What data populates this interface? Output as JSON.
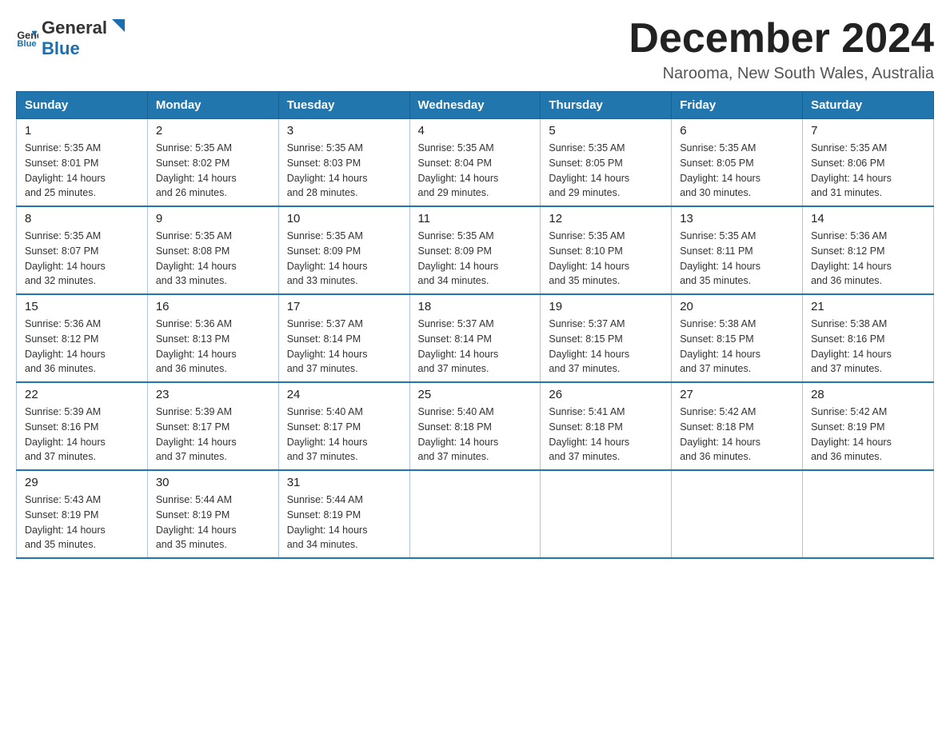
{
  "header": {
    "logo_general": "General",
    "logo_blue": "Blue",
    "month_title": "December 2024",
    "location": "Narooma, New South Wales, Australia"
  },
  "days_of_week": [
    "Sunday",
    "Monday",
    "Tuesday",
    "Wednesday",
    "Thursday",
    "Friday",
    "Saturday"
  ],
  "weeks": [
    [
      {
        "day": "1",
        "sunrise": "5:35 AM",
        "sunset": "8:01 PM",
        "daylight": "14 hours and 25 minutes."
      },
      {
        "day": "2",
        "sunrise": "5:35 AM",
        "sunset": "8:02 PM",
        "daylight": "14 hours and 26 minutes."
      },
      {
        "day": "3",
        "sunrise": "5:35 AM",
        "sunset": "8:03 PM",
        "daylight": "14 hours and 28 minutes."
      },
      {
        "day": "4",
        "sunrise": "5:35 AM",
        "sunset": "8:04 PM",
        "daylight": "14 hours and 29 minutes."
      },
      {
        "day": "5",
        "sunrise": "5:35 AM",
        "sunset": "8:05 PM",
        "daylight": "14 hours and 29 minutes."
      },
      {
        "day": "6",
        "sunrise": "5:35 AM",
        "sunset": "8:05 PM",
        "daylight": "14 hours and 30 minutes."
      },
      {
        "day": "7",
        "sunrise": "5:35 AM",
        "sunset": "8:06 PM",
        "daylight": "14 hours and 31 minutes."
      }
    ],
    [
      {
        "day": "8",
        "sunrise": "5:35 AM",
        "sunset": "8:07 PM",
        "daylight": "14 hours and 32 minutes."
      },
      {
        "day": "9",
        "sunrise": "5:35 AM",
        "sunset": "8:08 PM",
        "daylight": "14 hours and 33 minutes."
      },
      {
        "day": "10",
        "sunrise": "5:35 AM",
        "sunset": "8:09 PM",
        "daylight": "14 hours and 33 minutes."
      },
      {
        "day": "11",
        "sunrise": "5:35 AM",
        "sunset": "8:09 PM",
        "daylight": "14 hours and 34 minutes."
      },
      {
        "day": "12",
        "sunrise": "5:35 AM",
        "sunset": "8:10 PM",
        "daylight": "14 hours and 35 minutes."
      },
      {
        "day": "13",
        "sunrise": "5:35 AM",
        "sunset": "8:11 PM",
        "daylight": "14 hours and 35 minutes."
      },
      {
        "day": "14",
        "sunrise": "5:36 AM",
        "sunset": "8:12 PM",
        "daylight": "14 hours and 36 minutes."
      }
    ],
    [
      {
        "day": "15",
        "sunrise": "5:36 AM",
        "sunset": "8:12 PM",
        "daylight": "14 hours and 36 minutes."
      },
      {
        "day": "16",
        "sunrise": "5:36 AM",
        "sunset": "8:13 PM",
        "daylight": "14 hours and 36 minutes."
      },
      {
        "day": "17",
        "sunrise": "5:37 AM",
        "sunset": "8:14 PM",
        "daylight": "14 hours and 37 minutes."
      },
      {
        "day": "18",
        "sunrise": "5:37 AM",
        "sunset": "8:14 PM",
        "daylight": "14 hours and 37 minutes."
      },
      {
        "day": "19",
        "sunrise": "5:37 AM",
        "sunset": "8:15 PM",
        "daylight": "14 hours and 37 minutes."
      },
      {
        "day": "20",
        "sunrise": "5:38 AM",
        "sunset": "8:15 PM",
        "daylight": "14 hours and 37 minutes."
      },
      {
        "day": "21",
        "sunrise": "5:38 AM",
        "sunset": "8:16 PM",
        "daylight": "14 hours and 37 minutes."
      }
    ],
    [
      {
        "day": "22",
        "sunrise": "5:39 AM",
        "sunset": "8:16 PM",
        "daylight": "14 hours and 37 minutes."
      },
      {
        "day": "23",
        "sunrise": "5:39 AM",
        "sunset": "8:17 PM",
        "daylight": "14 hours and 37 minutes."
      },
      {
        "day": "24",
        "sunrise": "5:40 AM",
        "sunset": "8:17 PM",
        "daylight": "14 hours and 37 minutes."
      },
      {
        "day": "25",
        "sunrise": "5:40 AM",
        "sunset": "8:18 PM",
        "daylight": "14 hours and 37 minutes."
      },
      {
        "day": "26",
        "sunrise": "5:41 AM",
        "sunset": "8:18 PM",
        "daylight": "14 hours and 37 minutes."
      },
      {
        "day": "27",
        "sunrise": "5:42 AM",
        "sunset": "8:18 PM",
        "daylight": "14 hours and 36 minutes."
      },
      {
        "day": "28",
        "sunrise": "5:42 AM",
        "sunset": "8:19 PM",
        "daylight": "14 hours and 36 minutes."
      }
    ],
    [
      {
        "day": "29",
        "sunrise": "5:43 AM",
        "sunset": "8:19 PM",
        "daylight": "14 hours and 35 minutes."
      },
      {
        "day": "30",
        "sunrise": "5:44 AM",
        "sunset": "8:19 PM",
        "daylight": "14 hours and 35 minutes."
      },
      {
        "day": "31",
        "sunrise": "5:44 AM",
        "sunset": "8:19 PM",
        "daylight": "14 hours and 34 minutes."
      },
      null,
      null,
      null,
      null
    ]
  ],
  "labels": {
    "sunrise": "Sunrise:",
    "sunset": "Sunset:",
    "daylight": "Daylight:"
  }
}
